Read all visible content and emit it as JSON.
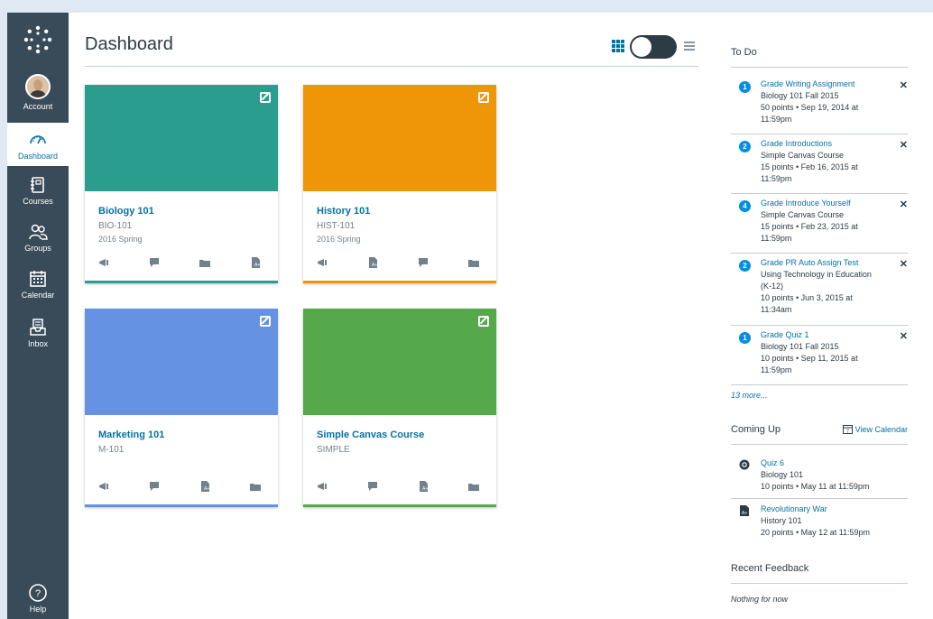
{
  "nav": {
    "items": [
      {
        "label": "Account",
        "icon": "avatar"
      },
      {
        "label": "Dashboard",
        "icon": "speedometer-icon"
      },
      {
        "label": "Courses",
        "icon": "book-icon"
      },
      {
        "label": "Groups",
        "icon": "people-icon"
      },
      {
        "label": "Calendar",
        "icon": "calendar-icon"
      },
      {
        "label": "Inbox",
        "icon": "inbox-icon"
      },
      {
        "label": "Help",
        "icon": "help-icon"
      }
    ],
    "background": "#394b58",
    "active_color": "#0770a3"
  },
  "page": {
    "title": "Dashboard"
  },
  "cards": [
    {
      "title": "Biology 101",
      "code": "BIO-101",
      "term": "2016 Spring",
      "color": "#2a9d8f",
      "icons": [
        "announcement-icon",
        "discussion-icon",
        "files-icon",
        "assignment-icon"
      ]
    },
    {
      "title": "History 101",
      "code": "HIST-101",
      "term": "2016 Spring",
      "color": "#ef9608",
      "icons": [
        "announcement-icon",
        "assignment-icon",
        "discussion-icon",
        "files-icon"
      ]
    },
    {
      "title": "Marketing 101",
      "code": "M-101",
      "term": "",
      "color": "#6592e2",
      "icons": [
        "announcement-icon",
        "discussion-icon",
        "assignment-icon",
        "files-icon"
      ]
    },
    {
      "title": "Simple Canvas Course",
      "code": "SIMPLE",
      "term": "",
      "color": "#55a94a",
      "icons": [
        "announcement-icon",
        "discussion-icon",
        "assignment-icon",
        "files-icon"
      ]
    }
  ],
  "todo": {
    "heading": "To Do",
    "items": [
      {
        "count": "1",
        "title": "Grade Writing Assignment",
        "lines": [
          "Biology 101 Fall 2015",
          "50 points • Sep 19, 2014 at",
          "11:59pm"
        ]
      },
      {
        "count": "2",
        "title": "Grade Introductions",
        "lines": [
          "Simple Canvas Course",
          "15 points • Feb 16, 2015 at",
          "11:59pm"
        ]
      },
      {
        "count": "4",
        "title": "Grade Introduce Yourself",
        "lines": [
          "Simple Canvas Course",
          "15 points • Feb 23, 2015 at",
          "11:59pm"
        ]
      },
      {
        "count": "2",
        "title": "Grade PR Auto Assign Test",
        "lines": [
          "Using Technology in Education",
          "(K-12)",
          "10 points • Jun 3, 2015 at",
          "11:34am"
        ]
      },
      {
        "count": "1",
        "title": "Grade Quiz 1",
        "lines": [
          "Biology 101 Fall 2015",
          "10 points • Sep 11, 2015 at",
          "11:59pm"
        ]
      }
    ],
    "more": "13 more..."
  },
  "coming_up": {
    "heading": "Coming Up",
    "view_calendar": "View Calendar",
    "items": [
      {
        "icon": "quiz-icon",
        "title": "Quiz 6",
        "course": "Biology 101",
        "detail": "10 points • May 11 at 11:59pm"
      },
      {
        "icon": "assignment-icon",
        "title": "Revolutionary War",
        "course": "History 101",
        "detail": "20 points • May 12 at 11:59pm"
      }
    ]
  },
  "feedback": {
    "heading": "Recent Feedback",
    "empty": "Nothing for now"
  }
}
